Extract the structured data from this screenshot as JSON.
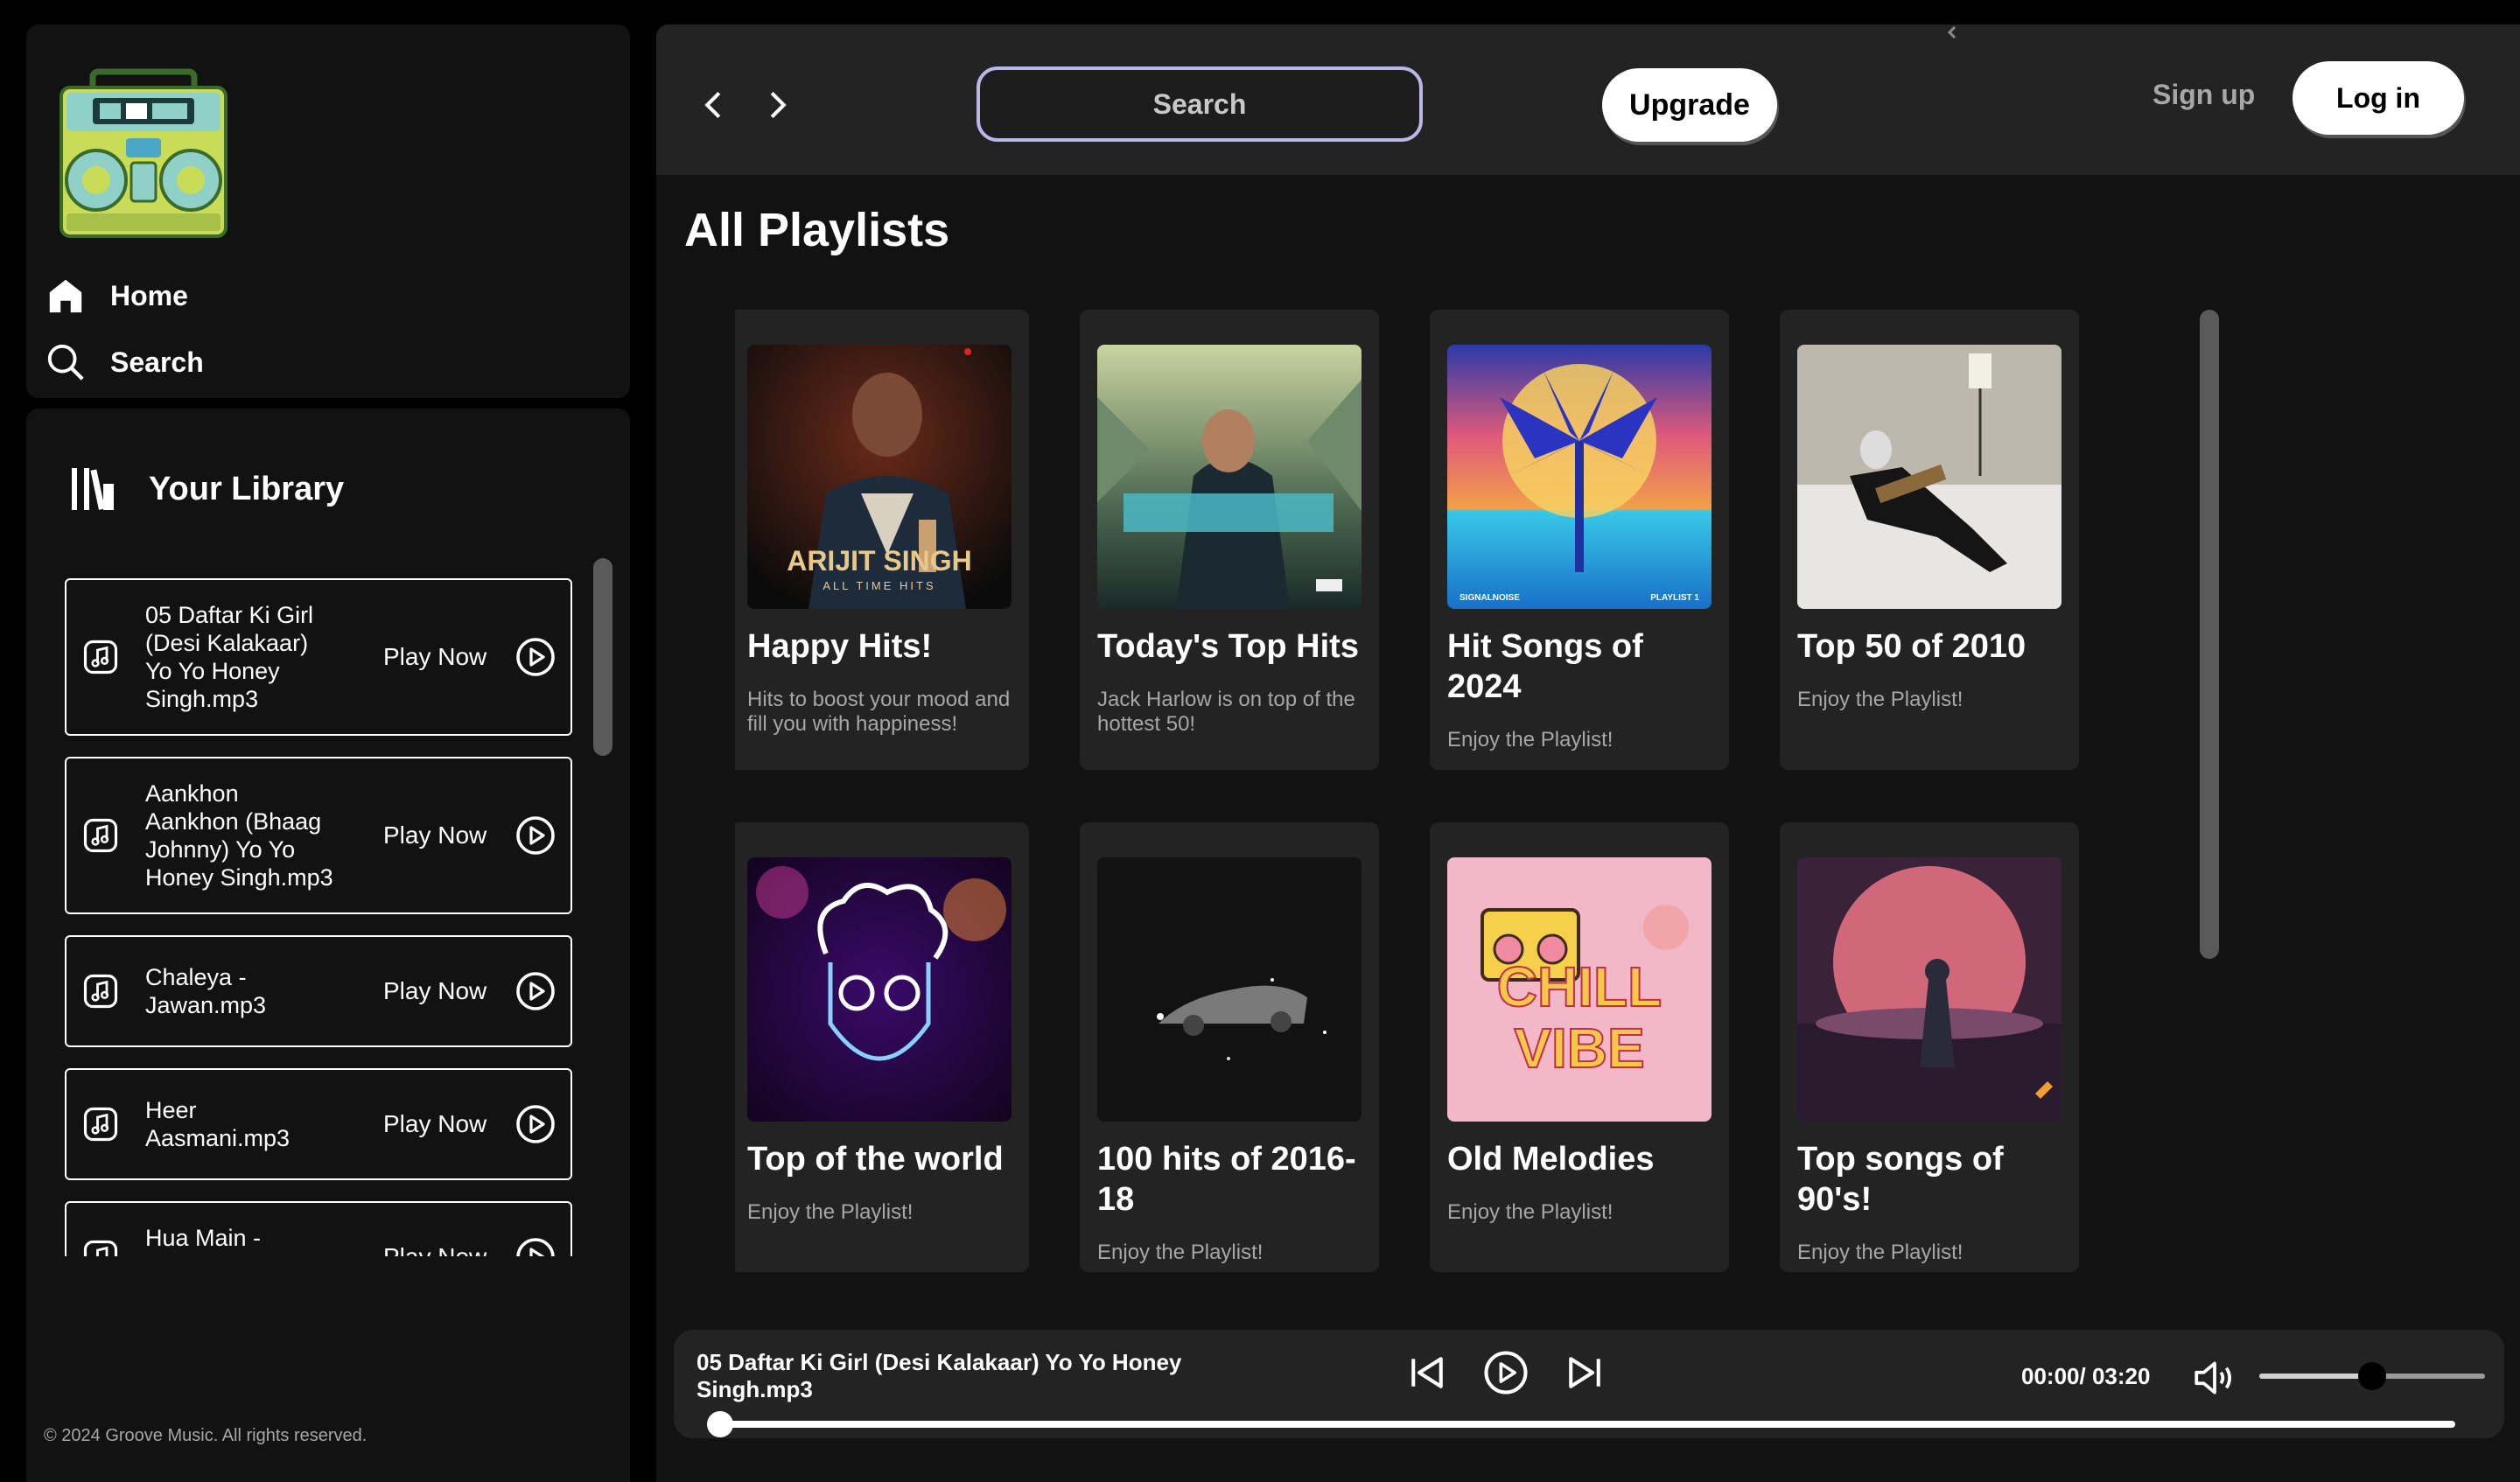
{
  "sidebar": {
    "nav": [
      {
        "label": "Home",
        "icon": "home-icon"
      },
      {
        "label": "Search",
        "icon": "search-icon"
      }
    ],
    "library": {
      "title": "Your Library",
      "items": [
        {
          "name": "05 Daftar Ki Girl (Desi Kalakaar) Yo Yo Honey Singh.mp3",
          "lines": [
            "05 Daftar Ki Girl",
            "(Desi Kalakaar)",
            "Yo Yo Honey",
            "Singh.mp3"
          ],
          "play_label": "Play Now"
        },
        {
          "name": "Aankhon Aankhon (Bhaag Johnny) Yo Yo Honey Singh.mp3",
          "lines": [
            "Aankhon",
            "Aankhon (Bhaag",
            "Johnny) Yo Yo",
            "Honey Singh.mp3"
          ],
          "play_label": "Play Now"
        },
        {
          "name": "Chaleya - Jawan.mp3",
          "lines": [
            "Chaleya -",
            "Jawan.mp3"
          ],
          "play_label": "Play Now"
        },
        {
          "name": "Heer Aasmani.mp3",
          "lines": [
            "Heer",
            "Aasmani.mp3"
          ],
          "play_label": "Play Now"
        },
        {
          "name": "Hua Main -",
          "lines": [
            "Hua Main -"
          ],
          "play_label": "Play Now"
        }
      ]
    },
    "copyright": "© 2024 Groove Music. All rights reserved."
  },
  "header": {
    "search_placeholder": "Search",
    "upgrade_label": "Upgrade",
    "signup_label": "Sign up",
    "login_label": "Log in"
  },
  "main": {
    "section_title": "All Playlists",
    "playlists": [
      {
        "title": "Happy Hits!",
        "description": "Hits to boost your mood and fill you with happiness!",
        "art_text": "ARIJIT SINGH",
        "art_subtext": "ALL TIME HITS"
      },
      {
        "title": "Today's Top Hits",
        "description": "Jack Harlow is on top of the hottest 50!"
      },
      {
        "title": "Hit Songs of 2024",
        "description": "Enjoy the Playlist!",
        "art_text": "SIGNALNOISE",
        "art_subtext": "PLAYLIST 1"
      },
      {
        "title": "Top 50 of 2010",
        "description": "Enjoy the Playlist!"
      },
      {
        "title": "Top of the world",
        "description": "Enjoy the Playlist!"
      },
      {
        "title": "100 hits of 2016-18",
        "description": "Enjoy the Playlist!"
      },
      {
        "title": "Old Melodies",
        "description": "Enjoy the Playlist!",
        "art_text": "CHILL",
        "art_subtext": "VIBE"
      },
      {
        "title": "Top songs of 90's!",
        "description": "Enjoy the Playlist!"
      }
    ]
  },
  "player": {
    "now_playing": "05 Daftar Ki Girl (Desi Kalakaar) Yo Yo Honey Singh.mp3",
    "now_playing_lines": [
      "05 Daftar Ki Girl (Desi Kalakaar) Yo Yo Honey",
      "Singh.mp3"
    ],
    "time": "00:00/ 03:20",
    "progress_fraction": 0.0,
    "volume_fraction": 0.5
  },
  "colors": {
    "background": "#000000",
    "panel": "#121212",
    "card": "#232323",
    "search_border": "#b9b6e8",
    "muted_text": "#a7a7a7"
  }
}
